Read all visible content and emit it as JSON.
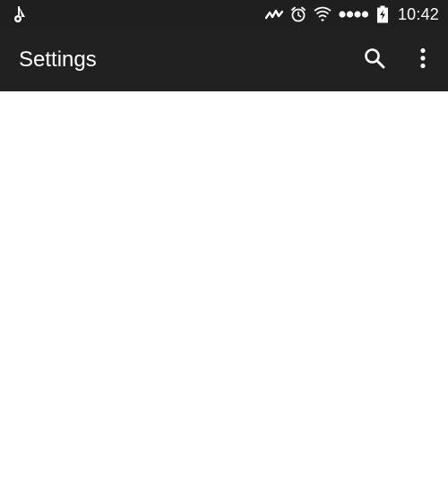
{
  "status_bar": {
    "time": "10:42",
    "icons": [
      "notification-icon",
      "activity-icon",
      "alarm-icon",
      "wifi-icon",
      "signal-icon",
      "battery-charging-icon"
    ]
  },
  "toolbar": {
    "title": "Settings",
    "actions": [
      "search-icon",
      "more-options-icon"
    ]
  },
  "colors": {
    "status_bar_bg": "#1f1f1f",
    "toolbar_bg": "#212121",
    "content_bg": "#ffffff",
    "text": "#ffffff"
  }
}
